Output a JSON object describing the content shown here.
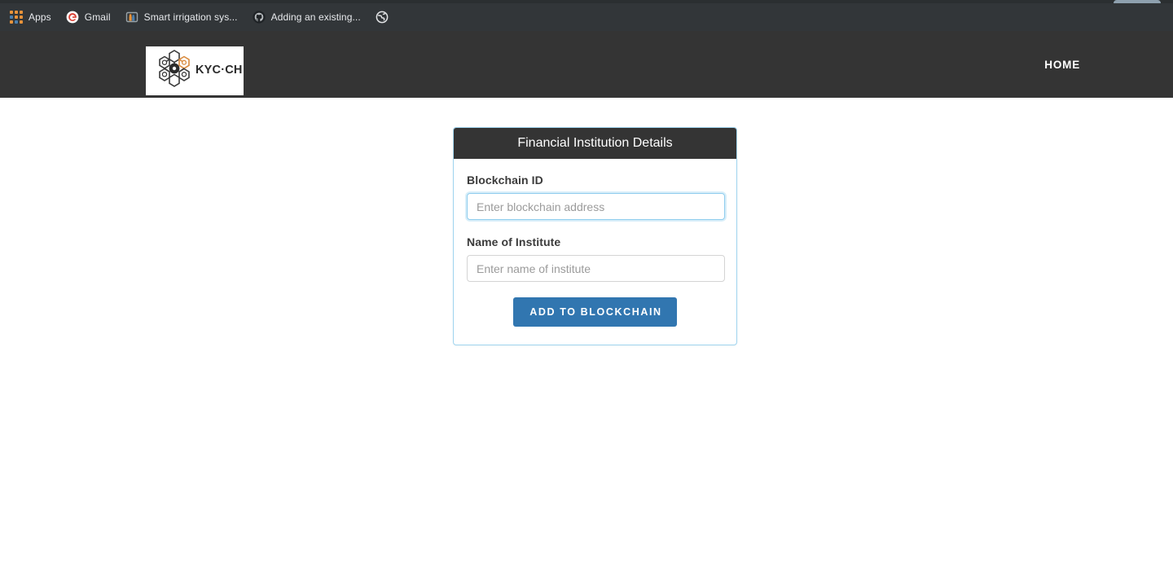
{
  "browser": {
    "bookmarks": [
      {
        "label": "Apps",
        "icon": "apps-grid-icon"
      },
      {
        "label": "Gmail",
        "icon": "gmail-icon"
      },
      {
        "label": "Smart irrigation sys...",
        "icon": "site-favicon"
      },
      {
        "label": "Adding an existing...",
        "icon": "github-icon"
      },
      {
        "label": "",
        "icon": "globe-icon"
      }
    ]
  },
  "navbar": {
    "brand": {
      "name": "KYC-CHAIN",
      "logo_icon": "kyc-chain-hexagon-logo"
    },
    "links": [
      {
        "label": "HOME"
      }
    ]
  },
  "card": {
    "header_title": "Financial Institution Details",
    "fields": [
      {
        "label": "Blockchain ID",
        "placeholder": "Enter blockchain address",
        "value": "",
        "focused": true
      },
      {
        "label": "Name of Institute",
        "placeholder": "Enter name of institute",
        "value": "",
        "focused": false
      }
    ],
    "submit_label": "ADD TO BLOCKCHAIN"
  },
  "colors": {
    "chrome_bg": "#323639",
    "navbar_bg": "#343434",
    "card_border": "#9fd4ef",
    "input_focus_border": "#8fcdee",
    "button_blue": "#3176b0",
    "logo_orange": "#d98a3d",
    "page_bg": "#ffffff"
  }
}
